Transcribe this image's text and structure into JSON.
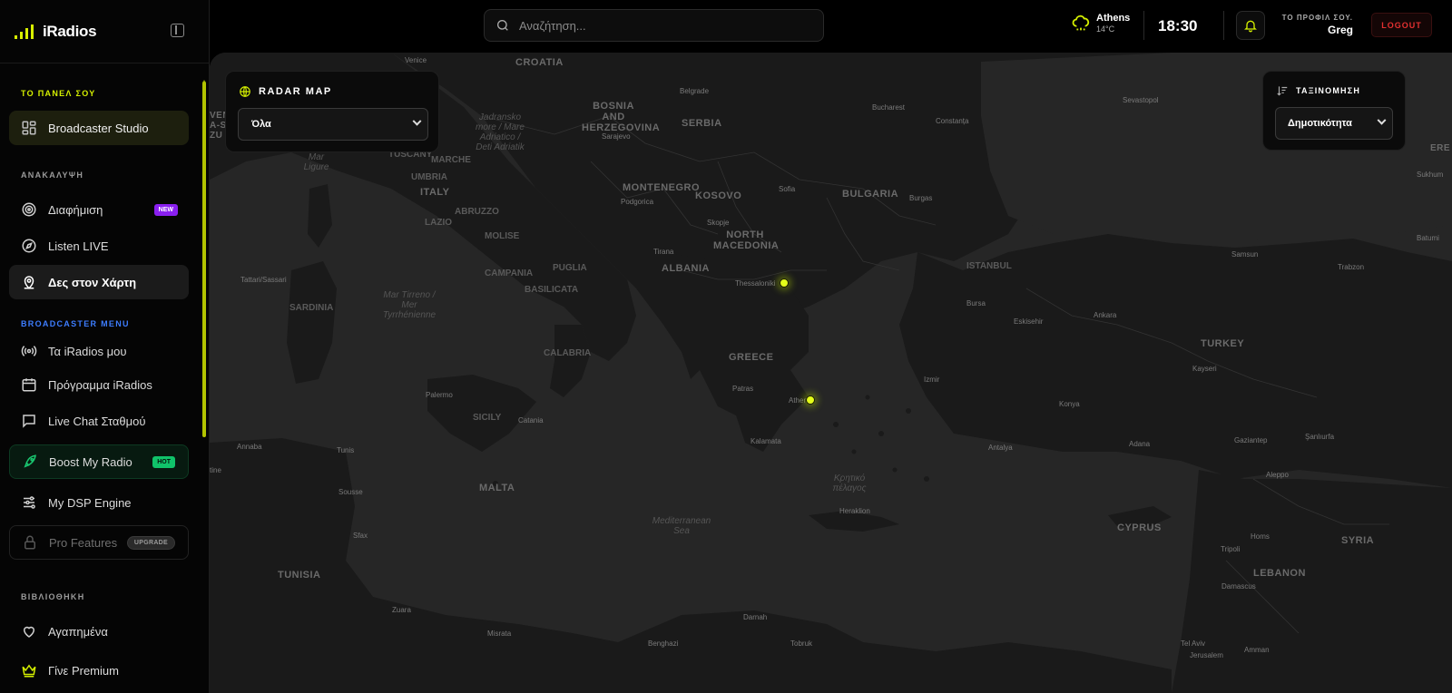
{
  "app": {
    "name": "iRadios"
  },
  "sidebar": {
    "sections": {
      "panel": "ΤΟ ΠΑΝΕΛ ΣΟΥ",
      "discovery": "ΑΝΑΚΑΛΥΨΗ",
      "broadcaster": "BROADCASTER MENU",
      "library": "ΒΙΒΛΙΟΘΗΚΗ"
    },
    "items": {
      "studio": "Broadcaster Studio",
      "advertising": "Διαφήμιση",
      "listen_live": "Listen LIVE",
      "map": "Δες στον Χάρτη",
      "my_iradios": "Τα iRadios μου",
      "schedule": "Πρόγραμμα iRadios",
      "live_chat": "Live Chat Σταθμού",
      "boost": "Boost My Radio",
      "dsp": "My DSP Engine",
      "pro": "Pro Features",
      "favorites": "Αγαπημένα",
      "premium": "Γίνε Premium"
    },
    "badges": {
      "new": "NEW",
      "hot": "HOT",
      "upgrade": "UPGRADE"
    }
  },
  "topbar": {
    "search_placeholder": "Αναζήτηση...",
    "weather": {
      "city": "Athens",
      "temp": "14°C",
      "icon": "cloud-rain-icon"
    },
    "time": "18:30",
    "profile_label": "ΤΟ ΠΡΟΦΙΛ ΣΟΥ.",
    "profile_name": "Greg",
    "logout": "LOGOUT"
  },
  "radar": {
    "title": "RADAR MAP",
    "filter_value": "Όλα"
  },
  "sort": {
    "title": "ΤΑΞΙΝΟΜΗΣΗ",
    "value": "Δημοτικότητα"
  },
  "map": {
    "countries": [
      "CROATIA",
      "BOSNIA AND HERZEGOVINA",
      "SERBIA",
      "MONTENEGRO",
      "KOSOVO",
      "BULGARIA",
      "NORTH MACEDONIA",
      "ALBANIA",
      "GREECE",
      "TURKEY",
      "ITALY",
      "TUNISIA",
      "MALTA",
      "CYPRUS",
      "SYRIA",
      "LEBANON"
    ],
    "regions": [
      "TUSCANY",
      "UMBRIA",
      "MARCHE",
      "ABRUZZO",
      "LAZIO",
      "MOLISE",
      "CAMPANIA",
      "PUGLIA",
      "BASILICATA",
      "CALABRIA",
      "SARDINIA",
      "SICILY",
      "ISTANBUL"
    ],
    "cities": [
      "Venice",
      "Belgrade",
      "Bucharest",
      "Sevastopol",
      "Constanța",
      "Sarajevo",
      "Sofia",
      "Burgas",
      "Podgorica",
      "Skopje",
      "Tirana",
      "Thessaloniki",
      "Bursa",
      "Eskisehir",
      "Ankara",
      "Samsun",
      "Trabzon",
      "Batumi",
      "Sukhum",
      "Izmir",
      "Konya",
      "Kayseri",
      "Patras",
      "Athens",
      "Kalamata",
      "Antalya",
      "Adana",
      "Gaziantep",
      "Şanlıurfa",
      "Aleppo",
      "Homs",
      "Tripoli",
      "Damascus",
      "Tel Aviv",
      "Jerusalem",
      "Amman",
      "Heraklion",
      "Tunis",
      "Sousse",
      "Sfax",
      "Annaba",
      "Palermo",
      "Catania",
      "Tattari/Sassari",
      "Zuara",
      "Misrata",
      "Benghazi",
      "Darnah",
      "Tobruk",
      "Nicosia"
    ],
    "seas": [
      "Mar Ligure",
      "Jadransko more / Mare Adriatico / Deti Adriatik",
      "Mar Tirreno / Mer Tyrrhénienne",
      "Mediterranean Sea",
      "Κρητικό πέλαγος"
    ],
    "station_markers": [
      "Thessaloniki",
      "Athens"
    ],
    "partial_labels": [
      "VENC",
      "A-SC",
      "ZU",
      "tine",
      "ERE"
    ]
  }
}
